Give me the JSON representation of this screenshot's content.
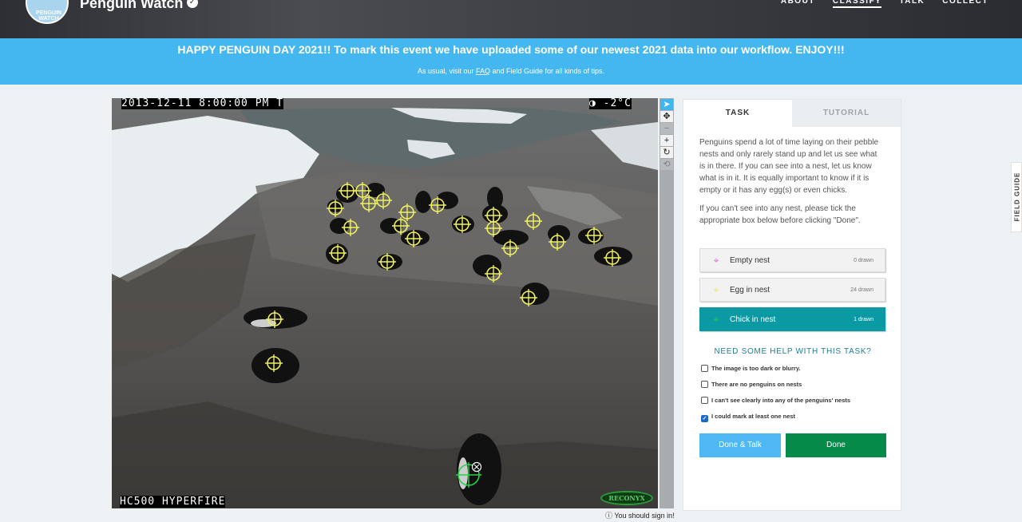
{
  "header": {
    "project_title": "Penguin Watch",
    "logo_line1": "PENGUIN",
    "logo_line2": "WATCH",
    "nav": [
      "ABOUT",
      "CLASSIFY",
      "TALK",
      "COLLECT"
    ],
    "active_nav": "CLASSIFY"
  },
  "banner": {
    "headline": "HAPPY PENGUIN DAY 2021!! To mark this event we have uploaded some of our newest 2021 data into our workflow. ENJOY!!!",
    "sub_before": "As usual, visit our ",
    "sub_link": "FAQ",
    "sub_after": " and Field Guide for all kinds of tips."
  },
  "subject": {
    "timestamp": "2013-12-11  8:00:00 PM    T",
    "temperature": "◑   -2°C",
    "camera": "HC500 HYPERFIRE",
    "brand_logo": "RECONYX",
    "marks_yellow_count": 24,
    "marks_green_count": 1
  },
  "viewer_tools": [
    "pointer-icon",
    "move-icon",
    "zoom-out-icon",
    "zoom-in-icon",
    "rotate-icon",
    "reset-icon"
  ],
  "signin_note": "You should sign in!",
  "task": {
    "tabs": [
      "TASK",
      "TUTORIAL"
    ],
    "active_tab": "TASK",
    "instructions_1": "Penguins spend a lot of time laying on their pebble nests and only rarely stand up and let us see what is in there. If you can see into a nest, let us know what is in it. It is equally important to know if it is empty or it has any egg(s) or even chicks.",
    "instructions_2": "If you can't see into any nest, please tick the appropriate box below before clicking \"Done\".",
    "tools": [
      {
        "label": "Empty nest",
        "count": "0 drawn",
        "color": "#e060e0"
      },
      {
        "label": "Egg in nest",
        "count": "24 drawn",
        "color": "#f0f060"
      },
      {
        "label": "Chick in nest",
        "count": "1 drawn",
        "color": "#2ad04a"
      }
    ],
    "selected_tool": "Chick in nest",
    "help_title": "NEED SOME HELP WITH THIS TASK?",
    "checkboxes": [
      {
        "label": "The image is too dark or blurry.",
        "checked": false
      },
      {
        "label": "There are no penguins on nests",
        "checked": false
      },
      {
        "label": "I can't see clearly into any of the penguins' nests",
        "checked": false
      },
      {
        "label": "I could mark at least one nest",
        "checked": true
      }
    ],
    "done_talk_label": "Done & Talk",
    "done_label": "Done"
  },
  "field_guide_label": "FIELD GUIDE",
  "colors": {
    "banner": "#45b7f0",
    "done": "#058a4a",
    "done_talk": "#4db8f3",
    "selected_tool": "#0b9aa3"
  }
}
